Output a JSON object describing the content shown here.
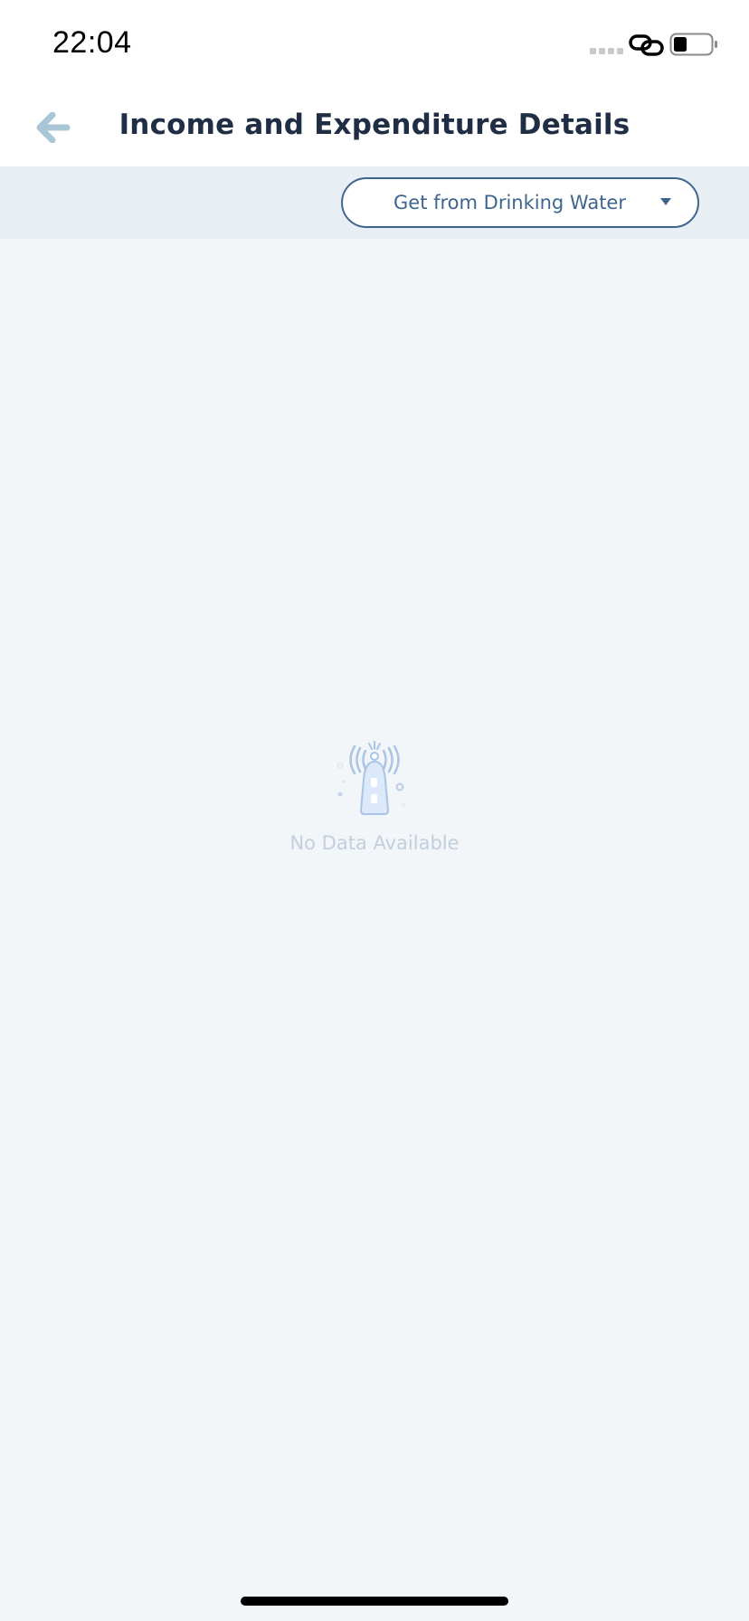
{
  "status_bar": {
    "time": "22:04",
    "icons": [
      "signal-dots-icon",
      "link-icon",
      "battery-icon"
    ]
  },
  "header": {
    "title": "Income and Expenditure Details",
    "back_icon": "back-arrow-icon"
  },
  "filter": {
    "selected": "Get from Drinking Water",
    "caret_icon": "caret-down-icon"
  },
  "empty_state": {
    "icon": "signal-tower-icon",
    "message": "No Data Available"
  },
  "colors": {
    "title": "#1f2d45",
    "accent": "#3e6590",
    "back_arrow": "#a9c6d6",
    "filter_bar_bg": "#e8eef4",
    "page_bg": "#f3f6f9",
    "empty_text": "#c2cfdc"
  }
}
